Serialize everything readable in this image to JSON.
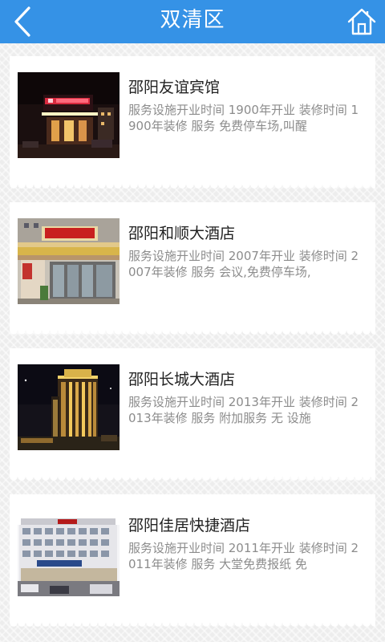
{
  "header": {
    "title": "双清区",
    "back_icon": "back-arrow-icon",
    "home_icon": "home-icon",
    "color": "#3592e6"
  },
  "hotels": [
    {
      "name": "邵阳友谊宾馆",
      "description": "服务设施开业时间 1900年开业 装修时间 1900年装修 服务 免费停车场,叫醒"
    },
    {
      "name": "邵阳和顺大酒店",
      "description": "服务设施开业时间 2007年开业 装修时间 2007年装修 服务 会议,免费停车场,"
    },
    {
      "name": "邵阳长城大酒店",
      "description": "服务设施开业时间 2013年开业 装修时间 2013年装修 服务 附加服务 无 设施"
    },
    {
      "name": "邵阳佳居快捷酒店",
      "description": "服务设施开业时间 2011年开业 装修时间 2011年装修 服务 大堂免费报纸 免"
    }
  ]
}
